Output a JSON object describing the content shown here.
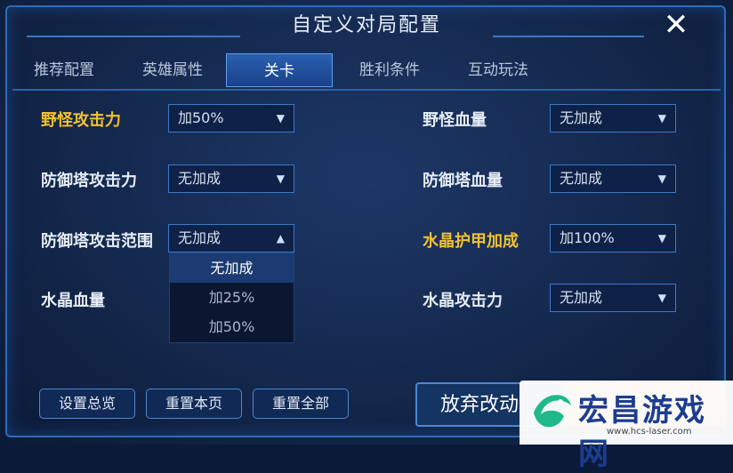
{
  "title": "自定义对局配置",
  "tabs": [
    "推荐配置",
    "英雄属性",
    "关卡",
    "胜利条件",
    "互动玩法"
  ],
  "settings": {
    "wild_attack": {
      "label": "野怪攻击力",
      "value": "加50%"
    },
    "wild_hp": {
      "label": "野怪血量",
      "value": "无加成"
    },
    "tower_attack": {
      "label": "防御塔攻击力",
      "value": "无加成"
    },
    "tower_hp": {
      "label": "防御塔血量",
      "value": "无加成"
    },
    "tower_range": {
      "label": "防御塔攻击范围",
      "value": "无加成"
    },
    "crystal_armor": {
      "label": "水晶护甲加成",
      "value": "加100%"
    },
    "crystal_hp": {
      "label": "水晶血量"
    },
    "crystal_attack": {
      "label": "水晶攻击力",
      "value": "无加成"
    }
  },
  "dropdown_options": [
    "无加成",
    "加25%",
    "加50%"
  ],
  "buttons": {
    "overview": "设置总览",
    "reset_page": "重置本页",
    "reset_all": "重置全部",
    "discard": "放弃改动"
  },
  "watermark": {
    "text": "宏昌游戏网",
    "url": "www.hcs-laser.com"
  },
  "colors": {
    "gold_label": "#f2c230",
    "accent": "#2e6bb8"
  }
}
